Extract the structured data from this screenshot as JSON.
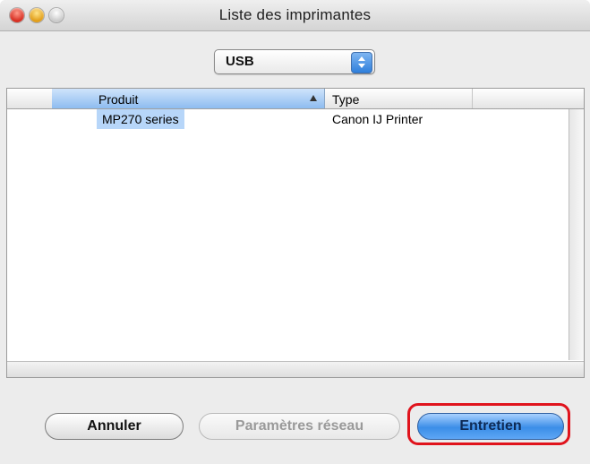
{
  "window": {
    "title": "Liste des imprimantes"
  },
  "popup": {
    "selected": "USB"
  },
  "table": {
    "columns": [
      "Produit",
      "Type"
    ],
    "rows": [
      {
        "product": "MP270 series",
        "type": "Canon IJ Printer"
      }
    ]
  },
  "buttons": {
    "cancel": "Annuler",
    "network": "Paramètres réseau",
    "maintenance": "Entretien"
  },
  "colors": {
    "selection": "#b7d6f9",
    "default_button": "#3b8ee8",
    "highlight": "#e0131c"
  }
}
